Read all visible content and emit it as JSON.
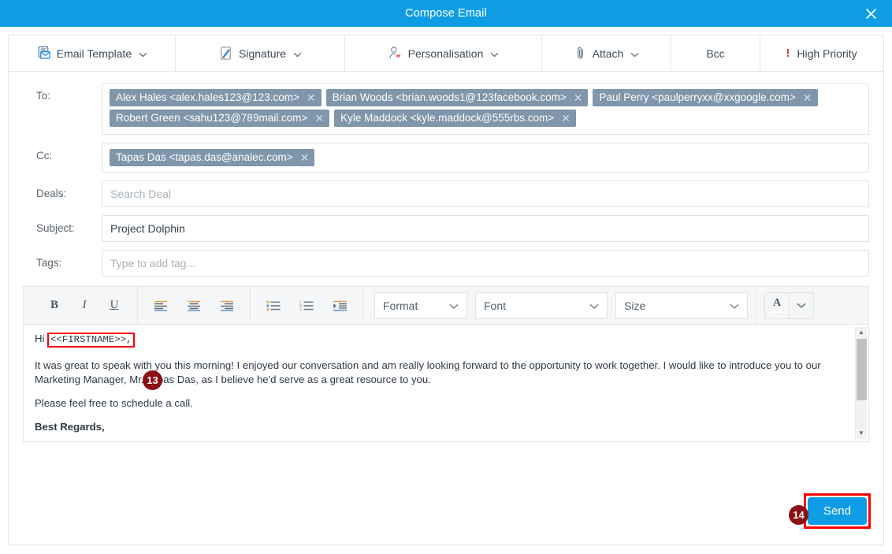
{
  "window": {
    "title": "Compose Email",
    "close_icon": "close-icon",
    "accent_color": "#0e9de5"
  },
  "actionbar": {
    "items": [
      {
        "label": "Email Template",
        "icon": "email-template-icon",
        "caret": true
      },
      {
        "label": "Signature",
        "icon": "signature-pen-icon",
        "caret": true
      },
      {
        "label": "Personalisation",
        "icon": "person-gear-icon",
        "caret": true
      },
      {
        "label": "Attach",
        "icon": "paperclip-icon",
        "caret": true
      },
      {
        "label": "Bcc",
        "icon": "",
        "caret": false
      },
      {
        "label": "High Priority",
        "icon": "exclamation-icon",
        "caret": false
      }
    ]
  },
  "fields": {
    "to": {
      "label": "To:",
      "chips": [
        "Alex Hales <alex.hales123@123.com>",
        "Brian Woods <brian.woods1@123facebook.com>",
        "Paul Perry <paulperryxx@xxgoogle.com>",
        "Robert Green <sahu123@789mail.com>",
        "Kyle Maddock <kyle.maddock@555rbs.com>"
      ]
    },
    "cc": {
      "label": "Cc:",
      "chips": [
        "Tapas Das <tapas.das@analec.com>"
      ]
    },
    "deals": {
      "label": "Deals:",
      "value": "",
      "placeholder": "Search Deal"
    },
    "subject": {
      "label": "Subject:",
      "value": "Project Dolphin",
      "placeholder": ""
    },
    "tags": {
      "label": "Tags:",
      "value": "",
      "placeholder": "Type to add tag..."
    }
  },
  "editor": {
    "toolbar": {
      "bold": "B",
      "italic": "I",
      "underline": "U",
      "align_left_icon": "align-left-icon",
      "align_center_icon": "align-center-icon",
      "align_right_icon": "align-right-icon",
      "bullet_list_icon": "bullet-list-icon",
      "numbered_list_icon": "numbered-list-icon",
      "indent_icon": "indent-icon",
      "format_select": "Format",
      "font_select": "Font",
      "size_select": "Size",
      "text_color_label": "A",
      "text_color_caret_icon": "chevron-down-icon"
    },
    "body": {
      "greeting_prefix": "Hi ",
      "placeholder_token": "<<FIRSTNAME>>,",
      "paragraph_1": "It was great to speak with you this morning! I enjoyed our conversation and am really looking forward to the opportunity to work together. I would like to introduce you to our Marketing Manager, Mr. Tapas Das, as I believe he'd serve as a great resource to you.",
      "paragraph_2": "Please feel free to schedule a call.",
      "signoff": "Best Regards,"
    },
    "scrollbar": {
      "up_arrow": "▲",
      "down_arrow": "▼"
    }
  },
  "footer": {
    "send_label": "Send"
  },
  "annotations": {
    "badge_13": "13",
    "badge_14": "14",
    "highlight_color": "#ff0000",
    "badge_color": "#8b1014"
  }
}
